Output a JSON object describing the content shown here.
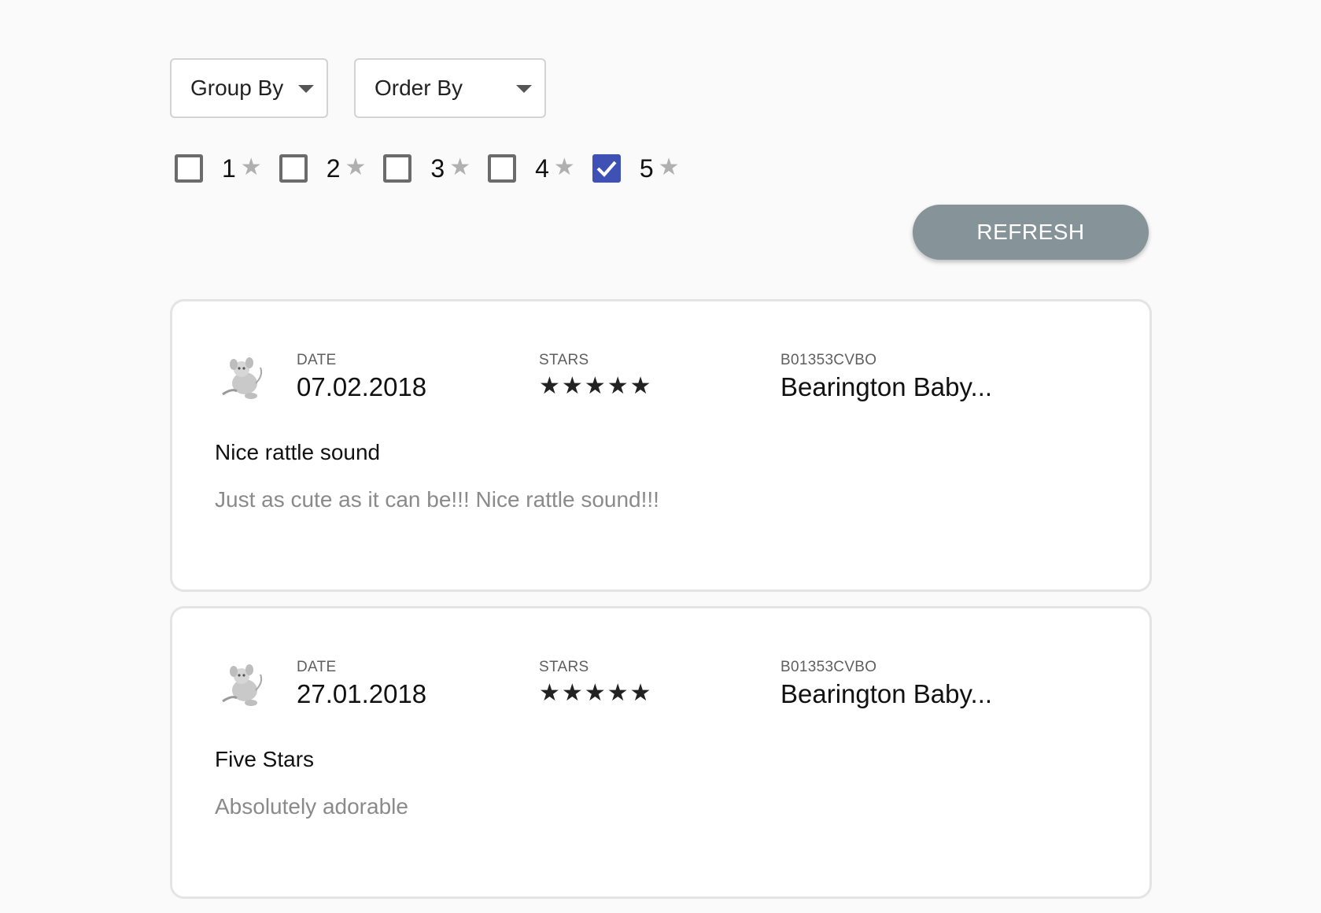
{
  "filters": {
    "group_by": "Group By",
    "order_by": "Order By",
    "star_options": [
      {
        "label": "1",
        "checked": false
      },
      {
        "label": "2",
        "checked": false
      },
      {
        "label": "3",
        "checked": false
      },
      {
        "label": "4",
        "checked": false
      },
      {
        "label": "5",
        "checked": true
      }
    ],
    "checkbox_color": "#3f51b5"
  },
  "refresh_label": "REFRESH",
  "reviews": [
    {
      "date_label": "DATE",
      "date": "07.02.2018",
      "stars_label": "STARS",
      "rating": 5,
      "product_id": "B01353CVBO",
      "product_name": "Bearington Baby...",
      "title": "Nice rattle sound",
      "text": "Just as cute as it can be!!! Nice rattle sound!!!"
    },
    {
      "date_label": "DATE",
      "date": "27.01.2018",
      "stars_label": "STARS",
      "rating": 5,
      "product_id": "B01353CVBO",
      "product_name": "Bearington Baby...",
      "title": "Five Stars",
      "text": "Absolutely adorable"
    }
  ]
}
